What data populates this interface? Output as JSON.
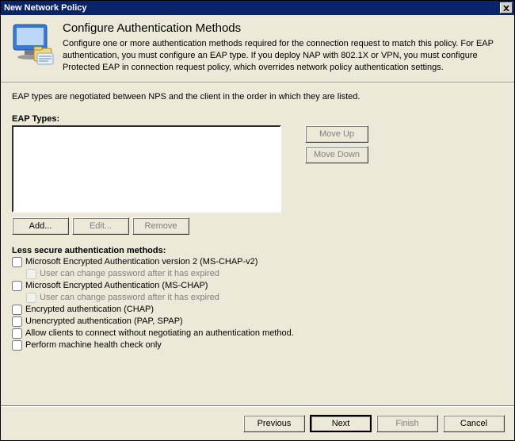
{
  "window": {
    "title": "New Network Policy"
  },
  "header": {
    "heading": "Configure Authentication Methods",
    "description": "Configure one or more authentication methods required for the connection request to match this policy. For EAP authentication, you must configure an EAP type. If you deploy NAP with 802.1X or VPN, you must configure Protected EAP in connection request policy, which overrides network policy authentication settings."
  },
  "body": {
    "note": "EAP types are negotiated between NPS and the client in the order in which they are listed.",
    "eap_label": "EAP Types:",
    "buttons": {
      "move_up": "Move Up",
      "move_down": "Move Down",
      "add": "Add...",
      "edit": "Edit...",
      "remove": "Remove"
    },
    "less_secure_label": "Less secure authentication methods:",
    "checks": {
      "mschap2": "Microsoft Encrypted Authentication version 2 (MS-CHAP-v2)",
      "mschap2_sub": "User can change password after it has expired",
      "mschap": "Microsoft Encrypted Authentication (MS-CHAP)",
      "mschap_sub": "User can change password after it has expired",
      "chap": "Encrypted authentication (CHAP)",
      "pap": "Unencrypted authentication (PAP, SPAP)",
      "allow_noneg": "Allow clients to connect without negotiating an authentication method.",
      "health_check": "Perform machine health check only"
    }
  },
  "footer": {
    "previous": "Previous",
    "next": "Next",
    "finish": "Finish",
    "cancel": "Cancel"
  }
}
